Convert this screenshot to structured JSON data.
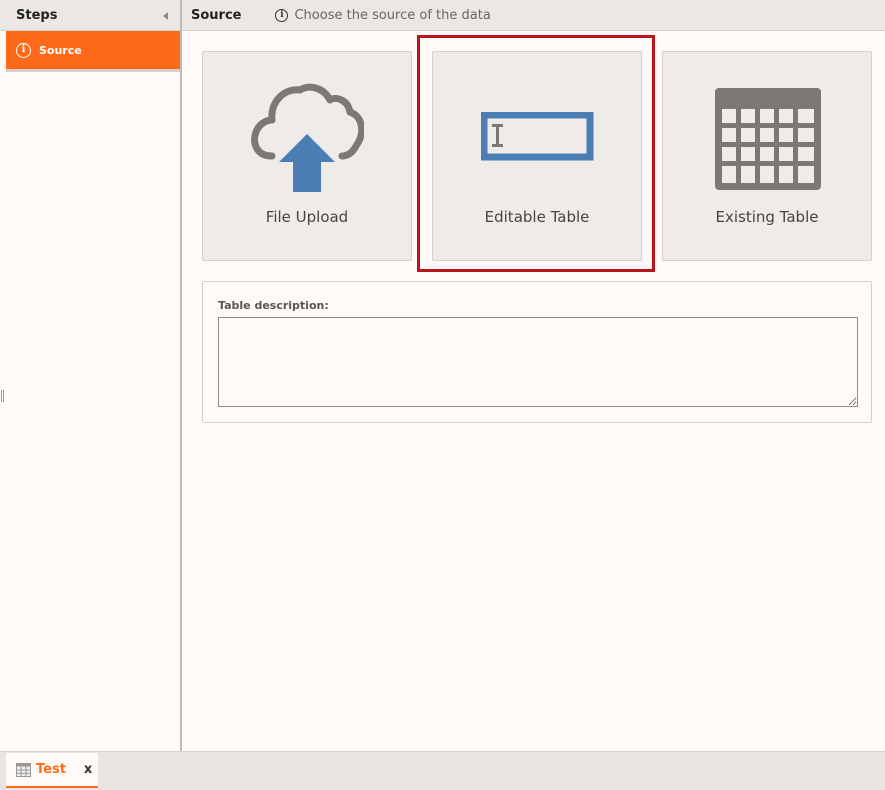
{
  "steps": {
    "header": "Steps",
    "items": [
      {
        "label": "Source",
        "icon": "info-icon",
        "active": true
      }
    ]
  },
  "content": {
    "title": "Source",
    "subtitle": "Choose the source of the data"
  },
  "options": [
    {
      "label": "File Upload",
      "icon": "cloud-upload-icon"
    },
    {
      "label": "Editable Table",
      "icon": "text-input-icon",
      "selected": true
    },
    {
      "label": "Existing Table",
      "icon": "table-grid-icon"
    }
  ],
  "description": {
    "label": "Table description:",
    "value": ""
  },
  "tabs": [
    {
      "label": "Test",
      "close": "x",
      "icon": "table-icon"
    }
  ],
  "colors": {
    "accent": "#ff6a1a",
    "highlight": "#b8161c",
    "icon_blue": "#4a7eb5",
    "icon_gray": "#7b7876"
  }
}
